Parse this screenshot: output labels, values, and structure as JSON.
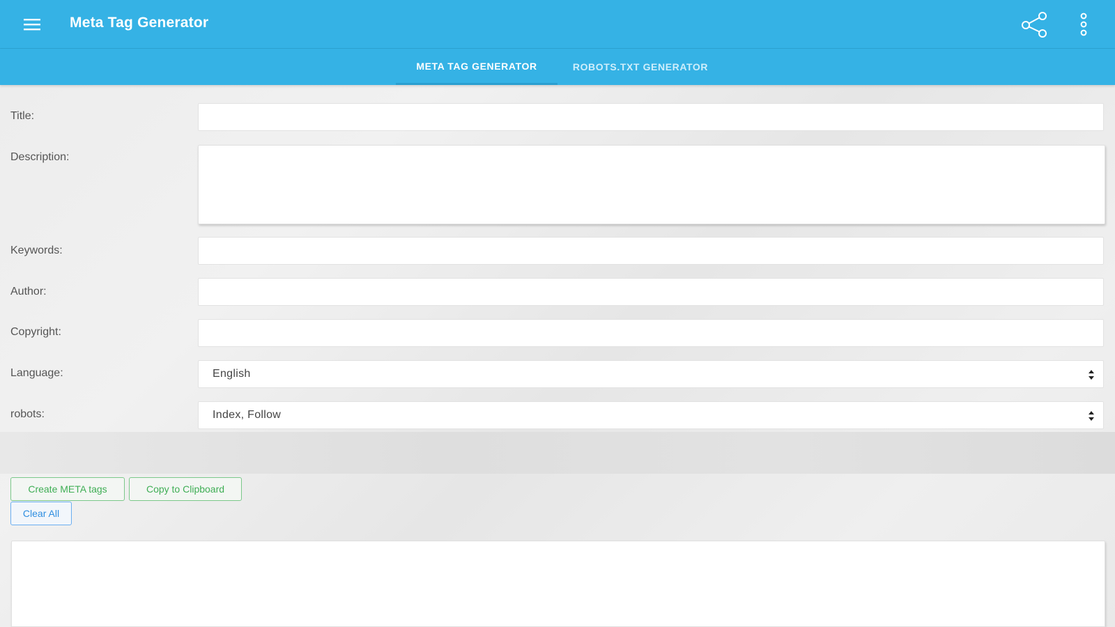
{
  "app": {
    "title": "Meta Tag Generator",
    "accent_color": "#35b2e5",
    "icons": {
      "menu": "hamburger-menu-icon",
      "share": "share-icon",
      "more": "more-vert-icon"
    }
  },
  "tabs": [
    {
      "label": "META TAG GENERATOR",
      "active": true
    },
    {
      "label": "ROBOTS.TXT GENERATOR",
      "active": false
    }
  ],
  "form": {
    "title": {
      "label": "Title:",
      "value": ""
    },
    "description": {
      "label": "Description:",
      "value": ""
    },
    "keywords": {
      "label": "Keywords:",
      "value": ""
    },
    "author": {
      "label": "Author:",
      "value": ""
    },
    "copyright": {
      "label": "Copyright:",
      "value": ""
    },
    "language": {
      "label": "Language:",
      "value": "English"
    },
    "robots": {
      "label": "robots:",
      "value": "Index, Follow"
    }
  },
  "actions": {
    "create": "Create META tags",
    "copy": "Copy to Clipboard",
    "clear": "Clear All",
    "colors": {
      "primary": "#3fae55",
      "secondary": "#2f8ee0"
    }
  },
  "output": {
    "value": ""
  }
}
